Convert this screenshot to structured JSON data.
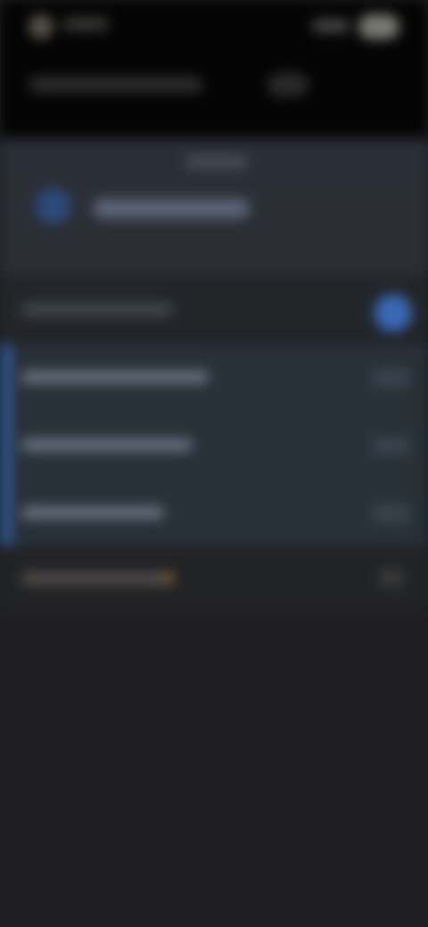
{
  "screen": {
    "state": "",
    "content_visibility": ""
  },
  "status_bar": {
    "time": ""
  },
  "app_bar": {
    "title": "",
    "action_label": ""
  },
  "panel": {
    "caption": "",
    "title": ""
  },
  "settings_rows": [
    {
      "label": ""
    },
    {
      "label": ""
    },
    {
      "label": ""
    },
    {
      "label": ""
    },
    {
      "label": ""
    }
  ],
  "colors": {
    "background": "#1f1f21",
    "accent_blue": "#3a69b6",
    "selection_bg": "#283038",
    "warning": "#7a5a32"
  }
}
